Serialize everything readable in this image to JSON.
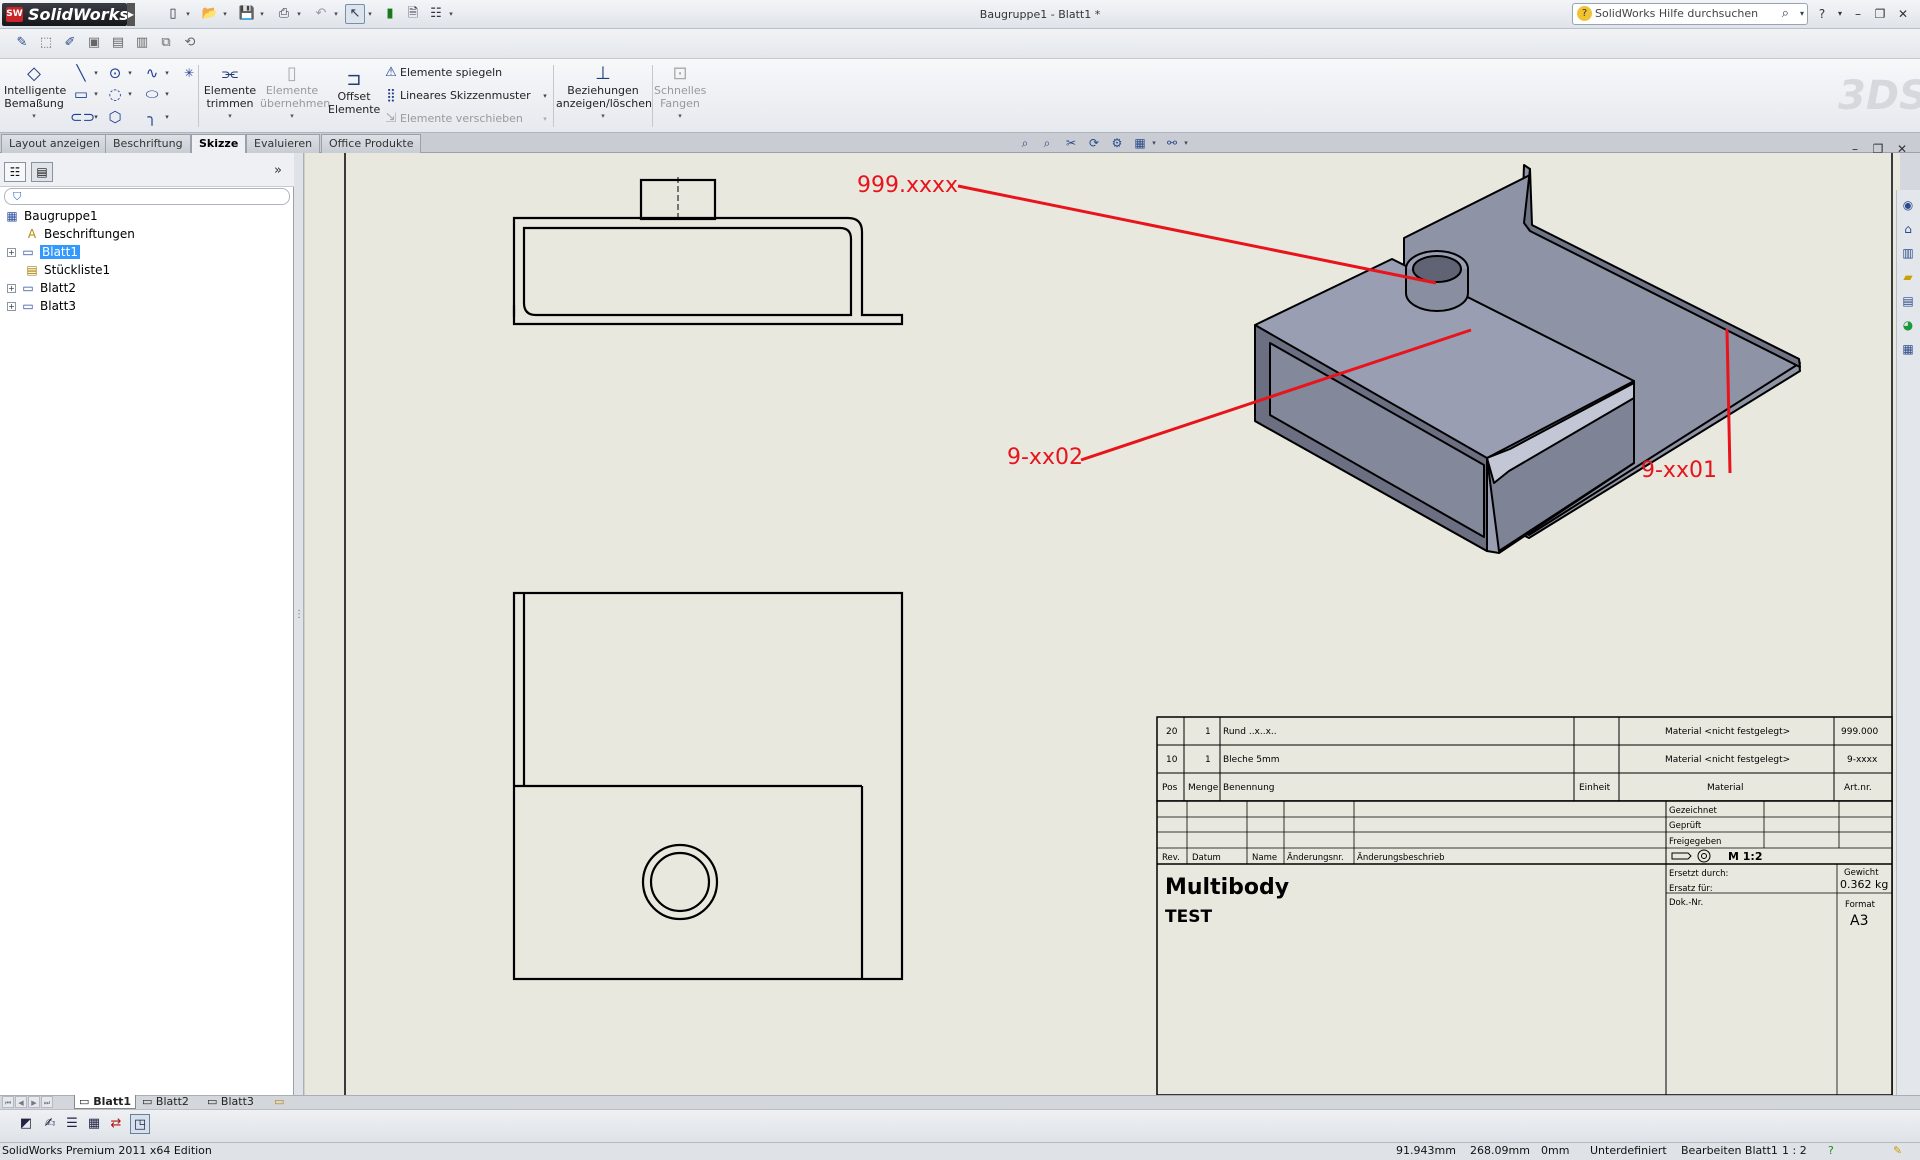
{
  "app": {
    "name": "SolidWorks",
    "logo_badge": "SW"
  },
  "titlebar": {
    "document_title": "Baugruppe1 - Blatt1 *"
  },
  "help": {
    "placeholder": "SolidWorks Hilfe durchsuchen"
  },
  "commands": {
    "smart_dimension": {
      "line1": "Intelligente",
      "line2": "Bemaßung"
    },
    "trim": {
      "line1": "Elemente",
      "line2": "trimmen"
    },
    "convert": {
      "line1": "Elemente",
      "line2": "übernehmen"
    },
    "offset": {
      "line1": "Offset",
      "line2": "Elemente"
    },
    "mirror": "Elemente spiegeln",
    "linear_pattern": "Lineares Skizzenmuster",
    "move": "Elemente verschieben",
    "relations": {
      "line1": "Beziehungen",
      "line2": "anzeigen/löschen"
    },
    "quick_snaps": {
      "line1": "Schnelles",
      "line2": "Fangen"
    }
  },
  "tabs": [
    {
      "label": "Layout anzeigen",
      "active": false
    },
    {
      "label": "Beschriftung",
      "active": false
    },
    {
      "label": "Skizze",
      "active": true
    },
    {
      "label": "Evaluieren",
      "active": false
    },
    {
      "label": "Office Produkte",
      "active": false
    }
  ],
  "tree": [
    {
      "label": "Baugruppe1",
      "icon": "drawing-icon",
      "expandable": false
    },
    {
      "label": "Beschriftungen",
      "icon": "annotations-icon",
      "expandable": false
    },
    {
      "label": "Blatt1",
      "icon": "sheet-icon",
      "expandable": true,
      "selected": true
    },
    {
      "label": "Stückliste1",
      "icon": "bom-icon",
      "expandable": false
    },
    {
      "label": "Blatt2",
      "icon": "sheet-icon",
      "expandable": true
    },
    {
      "label": "Blatt3",
      "icon": "sheet-icon",
      "expandable": true
    }
  ],
  "balloons": {
    "b1": "999.xxxx",
    "b2": "9-xx02",
    "b3": "9-xx01"
  },
  "bom": {
    "rows": [
      {
        "pos": "20",
        "menge": "1",
        "benennung": "Rund ..x..x..",
        "einheit": "",
        "material": "Material <nicht festgelegt>",
        "artnr": "999.000"
      },
      {
        "pos": "10",
        "menge": "1",
        "benennung": "Bleche 5mm",
        "einheit": "",
        "material": "Material <nicht festgelegt>",
        "artnr": "9-xxxx"
      }
    ],
    "headers": {
      "pos": "Pos",
      "menge": "Menge",
      "benennung": "Benennung",
      "einheit": "Einheit",
      "material": "Material",
      "artnr": "Art.nr."
    }
  },
  "titleblock": {
    "rev": "Rev.",
    "datum": "Datum",
    "name": "Name",
    "aenderungsnr": "Änderungsnr.",
    "aenderungsbeschrieb": "Änderungsbeschrieb",
    "gezeichnet": "Gezeichnet",
    "geprueft": "Geprüft",
    "freigegeben": "Freigegeben",
    "scale": "M 1:2",
    "title": "Multibody",
    "subtitle": "TEST",
    "ersetzt_durch": "Ersetzt durch:",
    "ersatz_fuer": "Ersatz für:",
    "doknr": "Dok.-Nr.",
    "gewicht_label": "Gewicht",
    "gewicht_value": "0.362 kg",
    "format_label": "Format",
    "format_value": "A3"
  },
  "sheet_tabs": [
    {
      "label": "Blatt1",
      "active": true
    },
    {
      "label": "Blatt2",
      "active": false
    },
    {
      "label": "Blatt3",
      "active": false
    }
  ],
  "status": {
    "edition": "SolidWorks Premium 2011 x64 Edition",
    "x": "91.943mm",
    "y": "268.09mm",
    "z": "0mm",
    "state": "Unterdefiniert",
    "editing": "Bearbeiten Blatt1",
    "scale": "1 : 2"
  },
  "colors": {
    "balloon": "#e8131b",
    "sheet": "#e8e8df",
    "part": "#8f93a6"
  }
}
